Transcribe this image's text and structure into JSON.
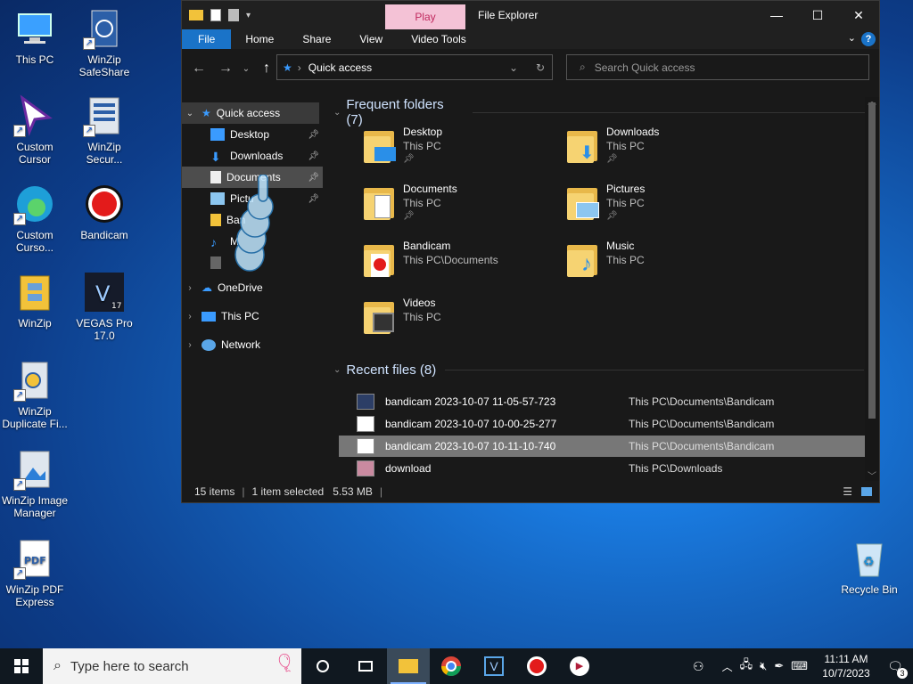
{
  "desktop_icons": [
    {
      "label": "This PC",
      "icon": "monitor-icon",
      "x": 0,
      "y": 0
    },
    {
      "label": "WinZip SafeShare",
      "icon": "winzip-safeshare-icon"
    },
    {
      "label": "Custom Cursor",
      "icon": "custom-cursor-icon"
    },
    {
      "label": "WinZip Secur...",
      "icon": "winzip-secure-icon"
    },
    {
      "label": "Custom Curso...",
      "icon": "edge-icon"
    },
    {
      "label": "Bandicam",
      "icon": "bandicam-icon"
    },
    {
      "label": "WinZip",
      "icon": "winzip-icon"
    },
    {
      "label": "VEGAS Pro 17.0",
      "icon": "vegas-icon"
    },
    {
      "label": "WinZip Duplicate Fi...",
      "icon": "winzip-duplicate-icon"
    },
    {
      "label": "WinZip Image Manager",
      "icon": "winzip-image-icon"
    },
    {
      "label": "WinZip PDF Express",
      "icon": "winzip-pdf-icon"
    },
    {
      "label": "Recycle Bin",
      "icon": "recycle-bin-icon"
    }
  ],
  "window": {
    "title": "File Explorer",
    "context_tab": "Play",
    "ribbon_tabs": [
      "File",
      "Home",
      "Share",
      "View",
      "Video Tools"
    ],
    "address": "Quick access",
    "search_placeholder": "Search Quick access"
  },
  "nav": {
    "quick_access": "Quick access",
    "items": [
      {
        "label": "Desktop",
        "icon": "desktop-folder-icon"
      },
      {
        "label": "Downloads",
        "icon": "downloads-icon"
      },
      {
        "label": "Documents",
        "icon": "documents-icon"
      },
      {
        "label": "Pictu",
        "icon": "pictures-icon"
      },
      {
        "label": "Ban",
        "icon": "folder-icon"
      },
      {
        "label": "M",
        "icon": "music-icon"
      }
    ],
    "onedrive": "OneDrive",
    "thispc": "This PC",
    "network": "Network"
  },
  "frequent": {
    "heading": "Frequent folders (7)",
    "tiles": [
      {
        "name": "Desktop",
        "sub": "This PC",
        "pinned": true
      },
      {
        "name": "Downloads",
        "sub": "This PC",
        "pinned": true
      },
      {
        "name": "Documents",
        "sub": "This PC",
        "pinned": true
      },
      {
        "name": "Pictures",
        "sub": "This PC",
        "pinned": true
      },
      {
        "name": "Bandicam",
        "sub": "This PC\\Documents",
        "pinned": false
      },
      {
        "name": "Music",
        "sub": "This PC",
        "pinned": false
      },
      {
        "name": "Videos",
        "sub": "This PC",
        "pinned": false
      }
    ]
  },
  "recent": {
    "heading": "Recent files (8)",
    "files": [
      {
        "name": "bandicam 2023-10-07 11-05-57-723",
        "location": "This PC\\Documents\\Bandicam"
      },
      {
        "name": "bandicam 2023-10-07 10-00-25-277",
        "location": "This PC\\Documents\\Bandicam"
      },
      {
        "name": "bandicam 2023-10-07 10-11-10-740",
        "location": "This PC\\Documents\\Bandicam"
      },
      {
        "name": "download",
        "location": "This PC\\Downloads"
      }
    ]
  },
  "status": {
    "items": "15 items",
    "selected": "1 item selected",
    "size": "5.53 MB"
  },
  "taskbar": {
    "search_placeholder": "Type here to search",
    "time": "11:11 AM",
    "date": "10/7/2023",
    "notifications": "3"
  }
}
